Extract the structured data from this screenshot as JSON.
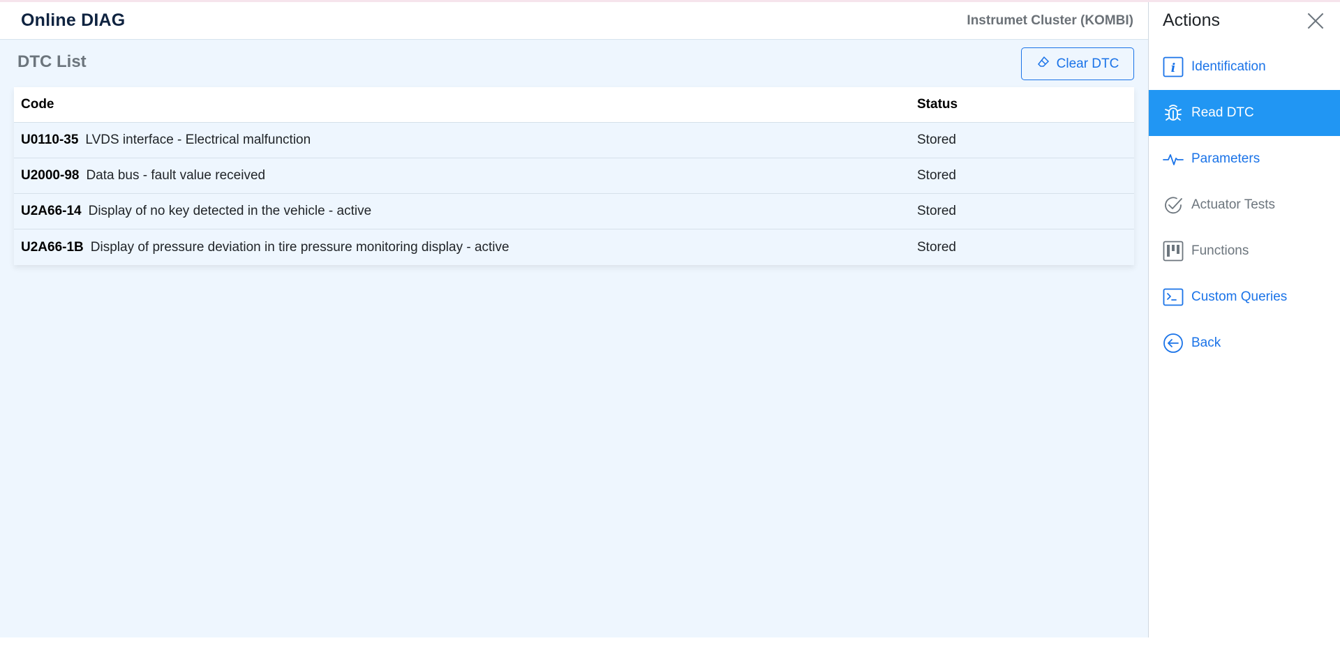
{
  "app": {
    "brand": "Online DIAG",
    "module": "Instrumet Cluster (KOMBI)"
  },
  "dtc": {
    "title": "DTC List",
    "clear_label": "Clear DTC",
    "columns": {
      "code": "Code",
      "status": "Status"
    },
    "rows": [
      {
        "code": "U0110-35",
        "description": "LVDS interface - Electrical malfunction",
        "status": "Stored"
      },
      {
        "code": "U2000-98",
        "description": "Data bus - fault value received",
        "status": "Stored"
      },
      {
        "code": "U2A66-14",
        "description": "Display of no key detected in the vehicle - active",
        "status": "Stored"
      },
      {
        "code": "U2A66-1B",
        "description": "Display of pressure deviation in tire pressure monitoring display - active",
        "status": "Stored"
      }
    ]
  },
  "sidebar": {
    "title": "Actions",
    "items": [
      {
        "label": "Identification",
        "icon": "info-icon"
      },
      {
        "label": "Read DTC",
        "icon": "bug-icon",
        "active": true
      },
      {
        "label": "Parameters",
        "icon": "pulse-icon"
      },
      {
        "label": "Actuator Tests",
        "icon": "check-circle-icon"
      },
      {
        "label": "Functions",
        "icon": "kanban-icon"
      },
      {
        "label": "Custom Queries",
        "icon": "terminal-icon"
      },
      {
        "label": "Back",
        "icon": "arrow-left-circle-icon"
      }
    ]
  },
  "colors": {
    "accent": "#1a73e8",
    "active_bg": "#2196f3",
    "content_bg": "#eef6fe",
    "brand_text": "#0f2340"
  }
}
